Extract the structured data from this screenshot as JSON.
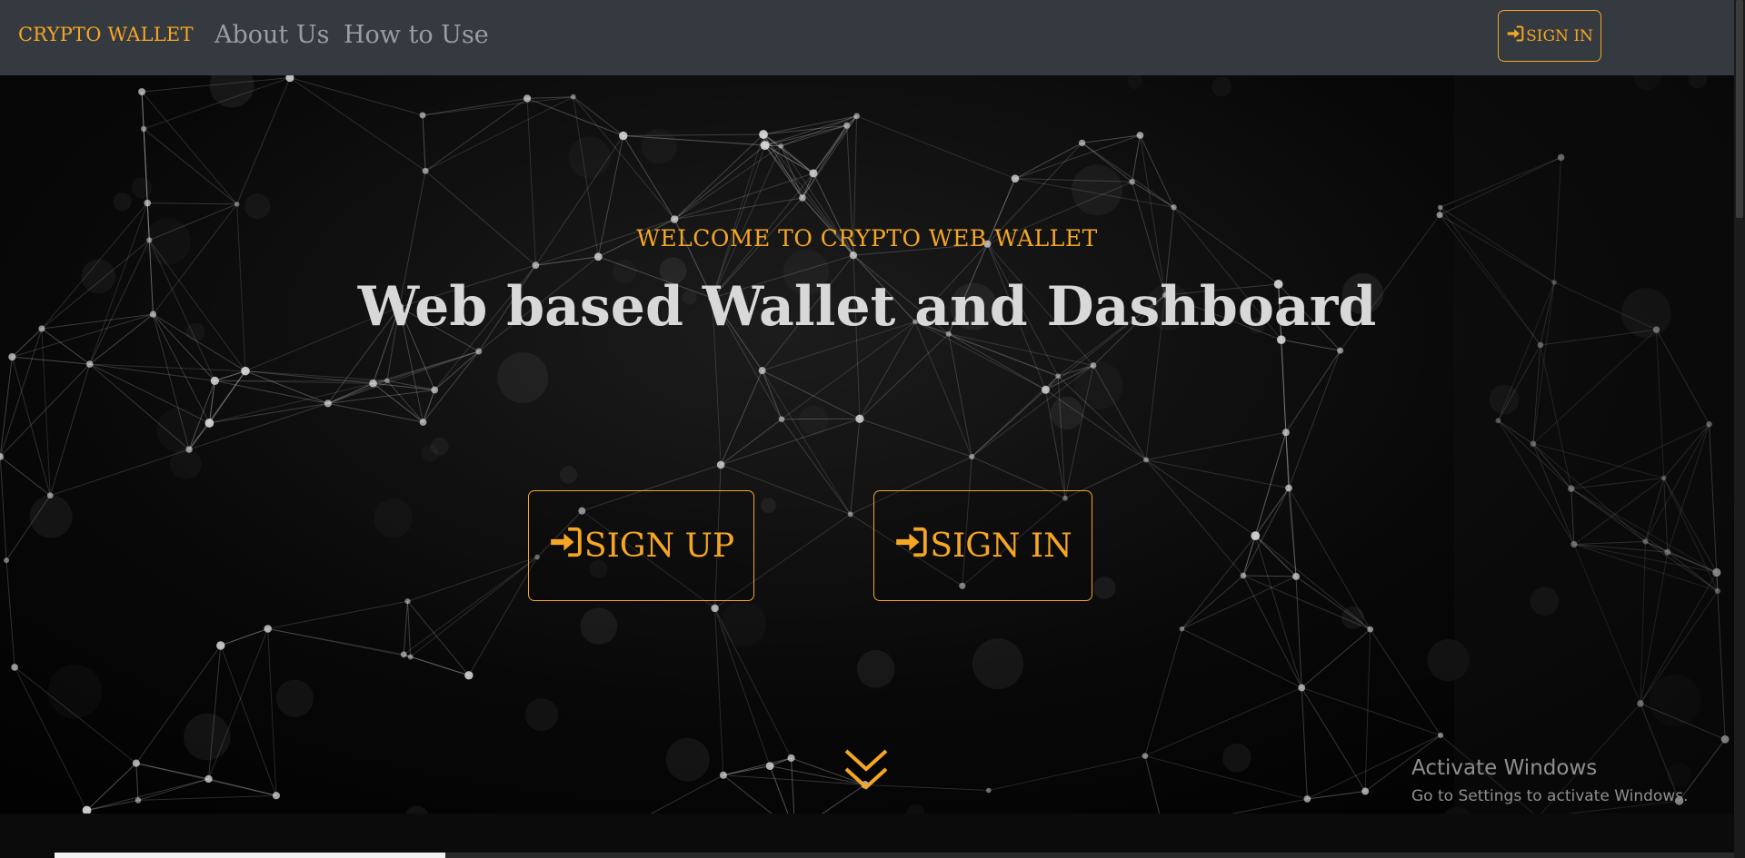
{
  "navbar": {
    "brand": "CRYPTO WALLET",
    "links": [
      "About Us",
      "How to Use"
    ],
    "signin_label": "SIGN IN"
  },
  "hero": {
    "welcome": "WELCOME TO CRYPTO WEB WALLET",
    "title": "Web based Wallet and Dashboard",
    "signup_label": "SIGN UP",
    "signin_label": "SIGN IN"
  },
  "watermark": {
    "title": "Activate Windows",
    "subtitle": "Go to Settings to activate Windows."
  },
  "icons": {
    "signin": "sign-in-icon",
    "scroll": "double-chevron-down-icon"
  },
  "colors": {
    "accent": "#f5a623",
    "navbar": "#343a40",
    "hero_text": "#d8d8d8"
  }
}
